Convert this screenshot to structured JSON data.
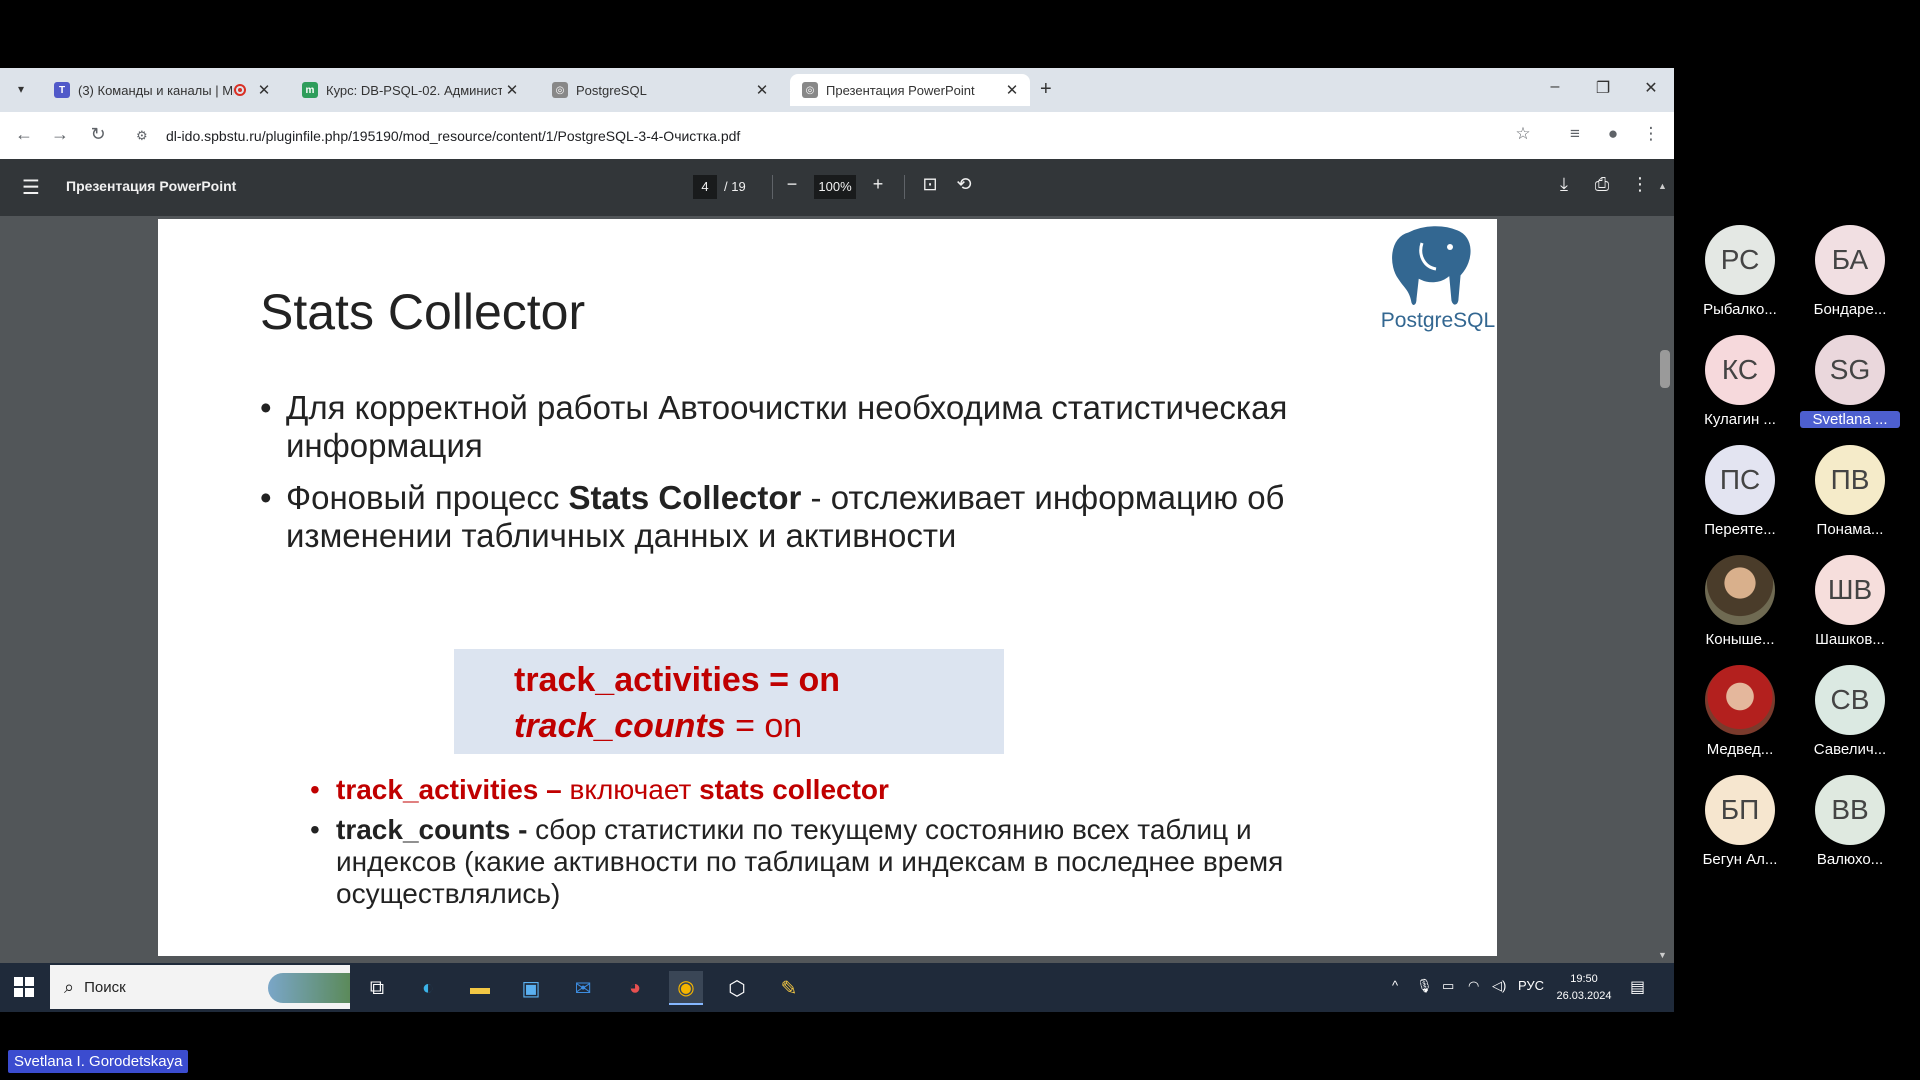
{
  "browser": {
    "tabs": [
      {
        "label": "(3) Команды и каналы | Ми",
        "recording": true
      },
      {
        "label": "Курс: DB-PSQL-02. Администр",
        "recording": false
      },
      {
        "label": "PostgreSQL",
        "recording": false
      },
      {
        "label": "Презентация PowerPoint",
        "recording": false,
        "active": true
      }
    ],
    "url": "dl-ido.spbstu.ru/pluginfile.php/195190/mod_resource/content/1/PostgreSQL-3-4-Очистка.pdf"
  },
  "pdf_viewer": {
    "title": "Презентация PowerPoint",
    "current_page": "4",
    "total_pages": "/ 19",
    "zoom": "100%"
  },
  "slide": {
    "title": "Stats Collector",
    "logo_text": "PostgreSQL",
    "bullet1": "Для корректной работы Автоочистки необходима статистическая информация",
    "bullet2_before": "Фоновый процесс ",
    "bullet2_bold": "Stats Collector",
    "bullet2_after": " - отслеживает информацию об изменении табличных данных и активности",
    "code_line1": "track_activities = on",
    "code_line2_key": "track_counts",
    "code_line2_rest": " = on",
    "sub1_key": "track_activities – ",
    "sub1_mid": "включает ",
    "sub1_bold": "stats collector",
    "sub2_key": "track_counts - ",
    "sub2_text": "сбор статистики по текущему состоянию всех таблиц и индексов (какие активности по таблицам и индексам в последнее время осуществлялись)"
  },
  "taskbar": {
    "search_placeholder": "Поиск",
    "language": "РУС",
    "time": "19:50",
    "date": "26.03.2024"
  },
  "participants": [
    {
      "initials": "РС",
      "name": "Рыбалко...",
      "color": "#e4e8e4"
    },
    {
      "initials": "БА",
      "name": "Бондаре...",
      "color": "#f1dfe2"
    },
    {
      "initials": "КС",
      "name": "Кулагин ...",
      "color": "#f6d9dc"
    },
    {
      "initials": "SG",
      "name": "Svetlana ...",
      "color": "#ead7dc"
    },
    {
      "initials": "ПС",
      "name": "Переяте...",
      "color": "#e3e4f1"
    },
    {
      "initials": "ПВ",
      "name": "Понама...",
      "color": "#f5ebc9"
    },
    {
      "initials": "",
      "name": "Коныше...",
      "color": ""
    },
    {
      "initials": "ШВ",
      "name": "Шашков...",
      "color": "#f6dedc"
    },
    {
      "initials": "",
      "name": "Медвед...",
      "color": ""
    },
    {
      "initials": "СВ",
      "name": "Савелич...",
      "color": "#dbe9e2"
    },
    {
      "initials": "БП",
      "name": "Бегун Ал...",
      "color": "#f6e6cf"
    },
    {
      "initials": "ВВ",
      "name": "Валюхо...",
      "color": "#dfe9e0"
    }
  ],
  "active_speaker": "Svetlana I. Gorodetskaya",
  "icons": {
    "tab_menu": "chevron-down-icon",
    "back": "back-arrow-icon",
    "forward": "forward-arrow-icon",
    "reload": "reload-icon",
    "bookmark": "star-icon",
    "download": "download-icon",
    "print": "print-icon"
  }
}
